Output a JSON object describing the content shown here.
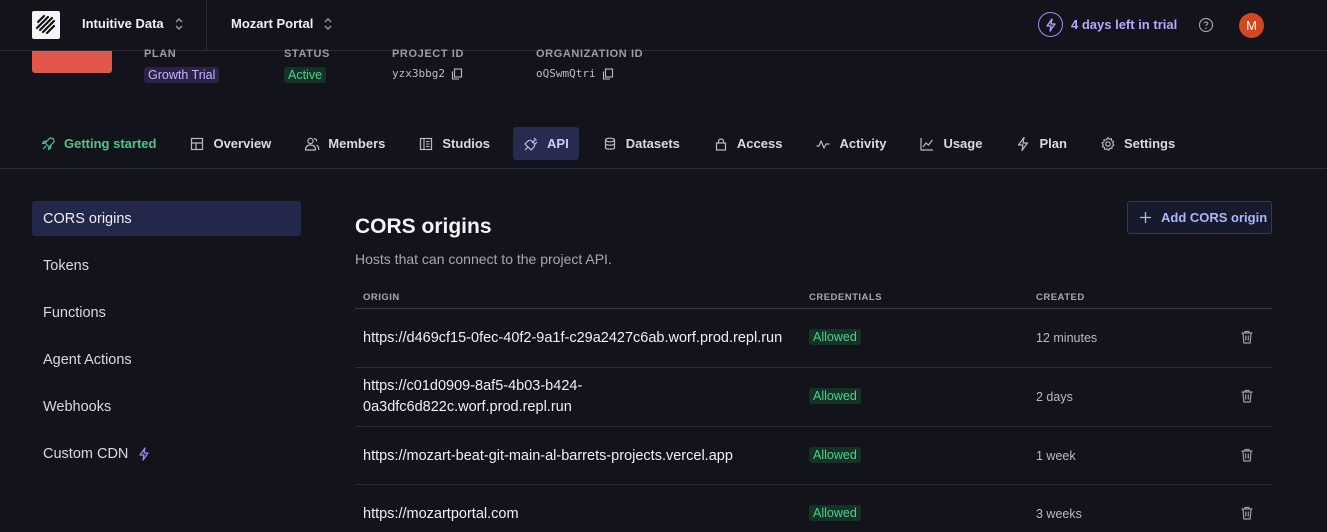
{
  "topbar": {
    "org_name": "Intuitive Data",
    "project_name": "Mozart Portal",
    "trial_text": "4 days left in trial",
    "avatar_initial": "M"
  },
  "project": {
    "plan_label": "PLAN",
    "plan_value": "Growth Trial",
    "status_label": "STATUS",
    "status_value": "Active",
    "project_id_label": "PROJECT ID",
    "project_id_value": "yzx3bbg2",
    "org_id_label": "ORGANIZATION ID",
    "org_id_value": "oQSwmQtri"
  },
  "tabs": [
    {
      "label": "Getting started",
      "icon": "rocket-icon"
    },
    {
      "label": "Overview",
      "icon": "grid-icon"
    },
    {
      "label": "Members",
      "icon": "users-icon"
    },
    {
      "label": "Studios",
      "icon": "studio-icon"
    },
    {
      "label": "API",
      "icon": "plug-icon",
      "active": true
    },
    {
      "label": "Datasets",
      "icon": "database-icon"
    },
    {
      "label": "Access",
      "icon": "lock-icon"
    },
    {
      "label": "Activity",
      "icon": "activity-icon"
    },
    {
      "label": "Usage",
      "icon": "chart-icon"
    },
    {
      "label": "Plan",
      "icon": "bolt-icon"
    },
    {
      "label": "Settings",
      "icon": "gear-icon"
    }
  ],
  "sidebar": {
    "items": [
      {
        "label": "CORS origins",
        "active": true
      },
      {
        "label": "Tokens"
      },
      {
        "label": "Functions"
      },
      {
        "label": "Agent Actions"
      },
      {
        "label": "Webhooks"
      },
      {
        "label": "Custom CDN",
        "icon": "bolt-icon"
      }
    ]
  },
  "main": {
    "title": "CORS origins",
    "subtitle": "Hosts that can connect to the project API.",
    "add_button_label": "Add CORS origin",
    "columns": [
      "ORIGIN",
      "CREDENTIALS",
      "CREATED"
    ],
    "rows": [
      {
        "origin": "https://d469cf15-0fec-40f2-9a1f-c29a2427c6ab.worf.prod.repl.run",
        "credentials": "Allowed",
        "created": "12 minutes"
      },
      {
        "origin": "https://c01d0909-8af5-4b03-b424-0a3dfc6d822c.worf.prod.repl.run",
        "credentials": "Allowed",
        "created": "2 days"
      },
      {
        "origin": "https://mozart-beat-git-main-al-barrets-projects.vercel.app",
        "credentials": "Allowed",
        "created": "1 week"
      },
      {
        "origin": "https://mozartportal.com",
        "credentials": "Allowed",
        "created": "3 weeks"
      }
    ]
  },
  "colors": {
    "background": "#13141b",
    "accent_purple": "#a48bf5",
    "accent_green": "#4ec489",
    "active_tab": "#272b4d",
    "brand_red": "#e2574c"
  }
}
